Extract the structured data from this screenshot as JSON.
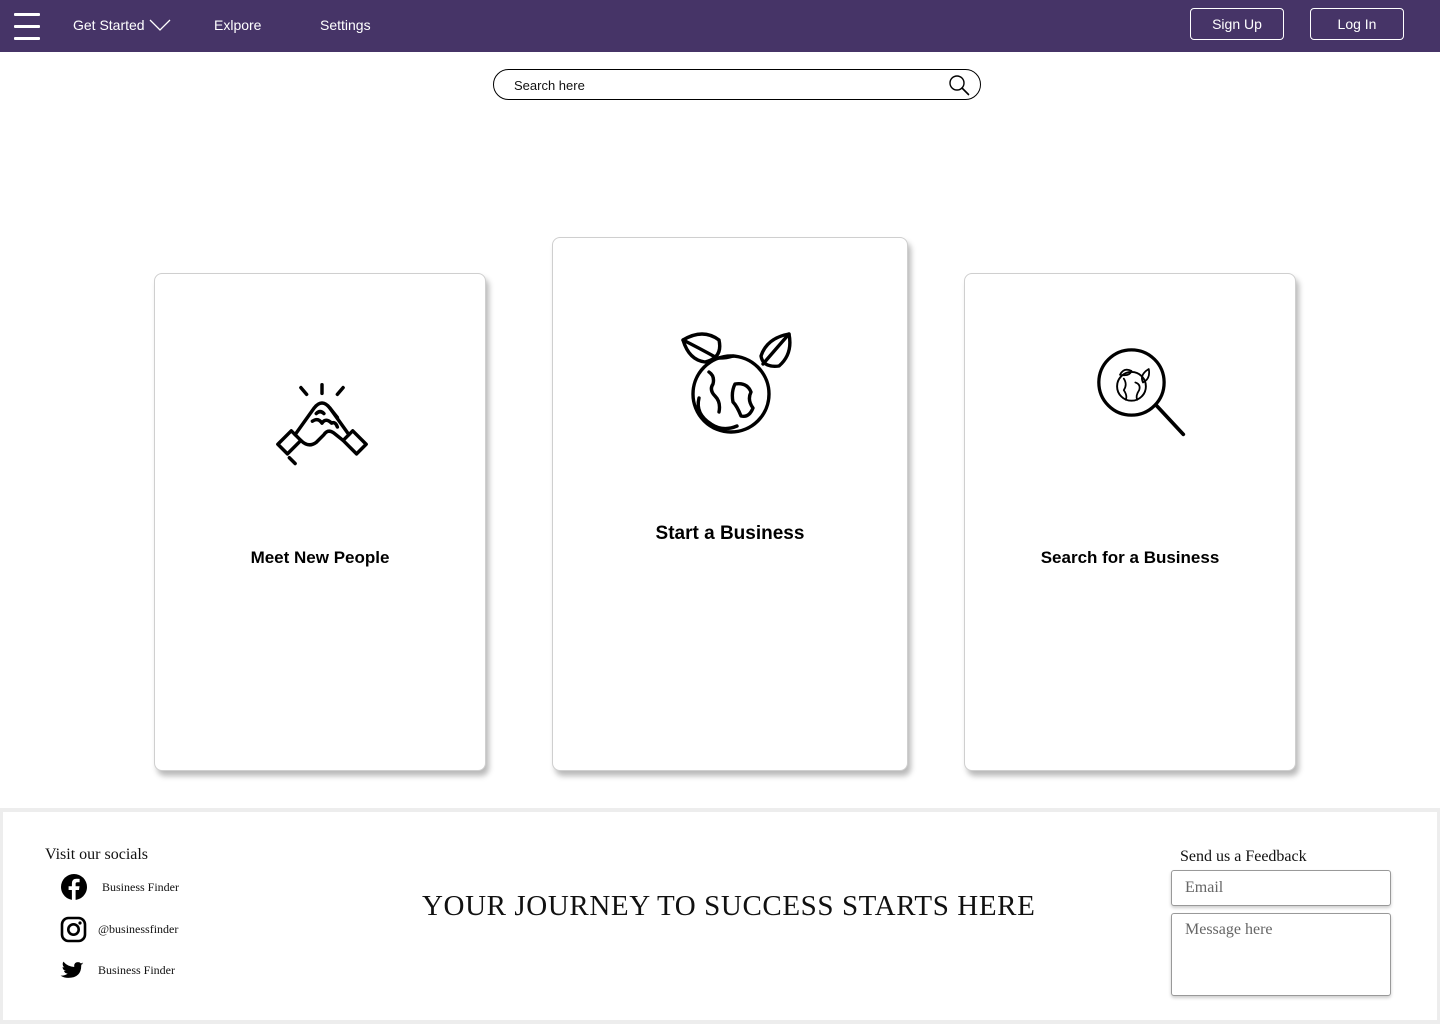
{
  "colors": {
    "navbar": "#463467",
    "nav_text": "#ffffff",
    "card_border": "#cfcfcf",
    "footer_border": "#ededed"
  },
  "nav": {
    "menu_icon": "hamburger-icon",
    "links": [
      {
        "label": "Get Started",
        "icon": "chevron-down-icon"
      },
      {
        "label": "Exlpore"
      },
      {
        "label": "Settings"
      }
    ],
    "signup_label": "Sign Up",
    "login_label": "Log In"
  },
  "search": {
    "placeholder": "Search here",
    "icon": "search-icon"
  },
  "cards": [
    {
      "title": "Meet New People",
      "icon": "handshake-icon"
    },
    {
      "title": "Start a Business",
      "icon": "globe-leaves-icon"
    },
    {
      "title": "Search for a Business",
      "icon": "magnifier-globe-icon"
    }
  ],
  "footer": {
    "socials_heading": "Visit our socials",
    "socials": [
      {
        "icon": "facebook-icon",
        "label": "Business Finder"
      },
      {
        "icon": "instagram-icon",
        "label": "@businessfinder"
      },
      {
        "icon": "twitter-icon",
        "label": "Business Finder"
      }
    ],
    "tagline": "YOUR JOURNEY TO SUCCESS STARTS HERE",
    "feedback": {
      "heading": "Send us a Feedback",
      "email_placeholder": "Email",
      "message_placeholder": "Message here"
    }
  }
}
